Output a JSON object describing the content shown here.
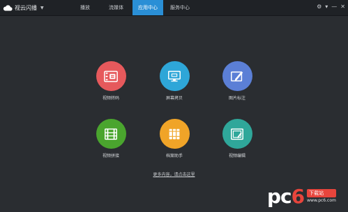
{
  "app": {
    "title": "视云闪播"
  },
  "tabs": [
    {
      "label": "播放",
      "active": false
    },
    {
      "label": "流媒体",
      "active": false
    },
    {
      "label": "应用中心",
      "active": true
    },
    {
      "label": "服务中心",
      "active": false
    }
  ],
  "window_controls": [
    "gear-icon",
    "chevron-down-icon",
    "minimize-icon",
    "close-icon"
  ],
  "apps": [
    {
      "label": "视频转码",
      "color": "#e6595c",
      "icon": "video-convert-icon"
    },
    {
      "label": "屏幕拷贝",
      "color": "#2ea6d8",
      "icon": "screen-copy-icon"
    },
    {
      "label": "图片标注",
      "color": "#5b7fd6",
      "icon": "image-annotate-icon"
    },
    {
      "label": "视频拼接",
      "color": "#4aa52e",
      "icon": "video-join-icon"
    },
    {
      "label": "档案助手",
      "color": "#f0a428",
      "icon": "archive-icon"
    },
    {
      "label": "视频编辑",
      "color": "#2fa79a",
      "icon": "video-edit-icon"
    }
  ],
  "footer": {
    "more_link": "更多内容，请点击这里"
  },
  "watermark": {
    "logo_main": "pc",
    "logo_six": "6",
    "badge": "下载站",
    "url": "www.pc6.com"
  }
}
